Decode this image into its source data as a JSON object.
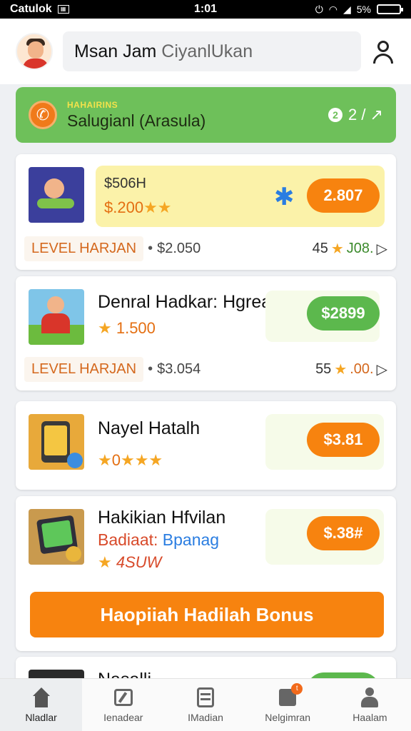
{
  "status_bar": {
    "carrier": "Catulok",
    "time": "1:01",
    "battery": "5%"
  },
  "header": {
    "search_text_dark": "Msan Jam",
    "search_text_light": "Ciyanl⁠Ukan"
  },
  "banner": {
    "small_label": "HAHAIRINS",
    "title": "Salugianl (Arasula)",
    "counter_icon": "2",
    "counter": "2 / ↗"
  },
  "cards": [
    {
      "price_label": "$506H",
      "stars_value": "$.200",
      "stars": "★★",
      "pill": "2.807",
      "level": "LEVEL HARJAN",
      "price": "$2.050",
      "count": "45",
      "sub": "J08.",
      "pill_color": "#f7830f"
    },
    {
      "title": "Denral Hadkar: Hgreall",
      "stars_value": "1.500",
      "pill": "$2899",
      "level": "LEVEL HARJAN",
      "price": "$3.054",
      "count": "55",
      "sub": ".00.",
      "pill_color": "#5cb84d"
    },
    {
      "title": "Nayel Hatalh",
      "stars_value": "0",
      "stars": "★★★",
      "pill": "$3.81",
      "pill_color": "#f7830f"
    },
    {
      "title": "Hakikian Hfvilan",
      "subtitle_a": "Badiaat:",
      "subtitle_b": "Bpanag",
      "stars_value": "4SUW",
      "pill": "$.38#",
      "bonus": "Haopiiah Hadilah Bonus",
      "pill_color": "#f7830f"
    }
  ],
  "partial_card": {
    "title": "Nasalli..."
  },
  "bottom_nav": [
    {
      "label": "Nladlar",
      "icon": "home-icon"
    },
    {
      "label": "Ienadear",
      "icon": "explore-icon"
    },
    {
      "label": "IMadian",
      "icon": "list-icon"
    },
    {
      "label": "Nelgimran",
      "icon": "message-icon",
      "badge": "t"
    },
    {
      "label": "Haalam",
      "icon": "profile-icon"
    }
  ]
}
